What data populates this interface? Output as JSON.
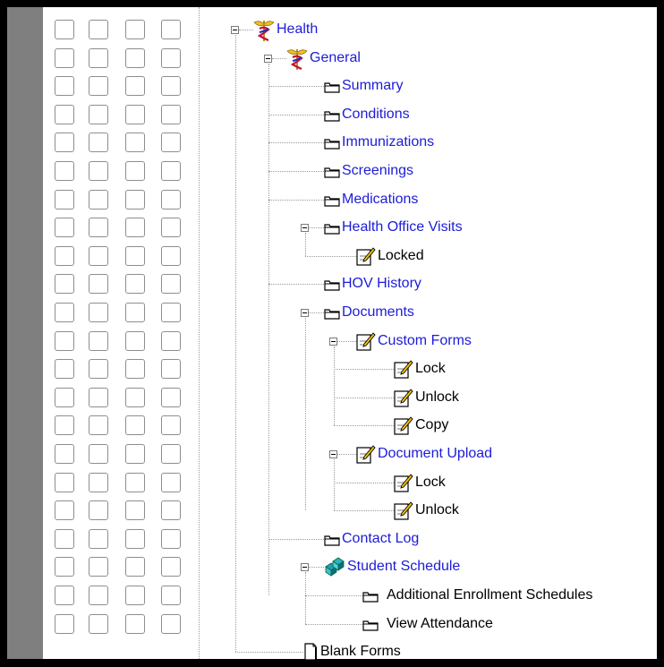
{
  "checkbox_grid": {
    "rows": 22,
    "columns": 4
  },
  "tree": [
    {
      "label": "Health",
      "icon": "caduceus-icon",
      "style": "link",
      "expanded": true,
      "depth": 0
    },
    {
      "label": "General",
      "icon": "caduceus-icon",
      "style": "link",
      "expanded": true,
      "depth": 1
    },
    {
      "label": "Summary",
      "icon": "folder-icon",
      "style": "link",
      "depth": 2
    },
    {
      "label": "Conditions",
      "icon": "folder-icon",
      "style": "link",
      "depth": 2
    },
    {
      "label": "Immunizations",
      "icon": "folder-icon",
      "style": "link",
      "depth": 2
    },
    {
      "label": "Screenings",
      "icon": "folder-icon",
      "style": "link",
      "depth": 2
    },
    {
      "label": "Medications",
      "icon": "folder-icon",
      "style": "link",
      "depth": 2
    },
    {
      "label": "Health Office Visits",
      "icon": "folder-icon",
      "style": "link",
      "expanded": true,
      "depth": 2
    },
    {
      "label": "Locked",
      "icon": "edit-note-icon",
      "style": "plain",
      "depth": 3
    },
    {
      "label": "HOV History",
      "icon": "folder-icon",
      "style": "link",
      "depth": 2
    },
    {
      "label": "Documents",
      "icon": "folder-icon",
      "style": "link",
      "expanded": true,
      "depth": 2
    },
    {
      "label": "Custom Forms",
      "icon": "edit-note-icon",
      "style": "link",
      "expanded": true,
      "depth": 3
    },
    {
      "label": "Lock",
      "icon": "edit-note-icon",
      "style": "plain",
      "depth": 4
    },
    {
      "label": "Unlock",
      "icon": "edit-note-icon",
      "style": "plain",
      "depth": 4
    },
    {
      "label": "Copy",
      "icon": "edit-note-icon",
      "style": "plain",
      "depth": 4
    },
    {
      "label": "Document Upload",
      "icon": "edit-note-icon",
      "style": "link",
      "expanded": true,
      "depth": 3
    },
    {
      "label": "Lock",
      "icon": "edit-note-icon",
      "style": "plain",
      "depth": 4
    },
    {
      "label": "Unlock",
      "icon": "edit-note-icon",
      "style": "plain",
      "depth": 4
    },
    {
      "label": "Contact Log",
      "icon": "folder-icon",
      "style": "link",
      "depth": 2
    },
    {
      "label": "Student Schedule",
      "icon": "schedule-blocks-icon",
      "style": "link",
      "expanded": true,
      "depth": 2
    },
    {
      "label": "Additional Enrollment Schedules",
      "icon": "folder-icon",
      "style": "plain",
      "depth": 3
    },
    {
      "label": "View Attendance",
      "icon": "folder-icon",
      "style": "plain",
      "depth": 3
    },
    {
      "label": "Blank Forms",
      "icon": "document-icon",
      "style": "plain",
      "depth": 1
    }
  ],
  "colors": {
    "link": "#1c1cd8",
    "text": "#000000",
    "gutter": "#7f7f7f",
    "frame": "#000000"
  }
}
